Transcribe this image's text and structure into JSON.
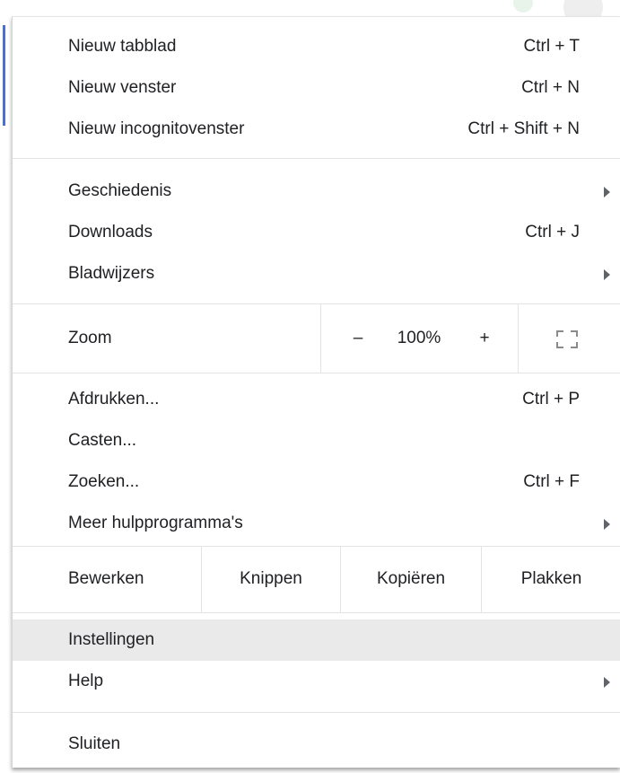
{
  "colors": {
    "accent": "#4a6fd1",
    "highlight": "#eaeaea",
    "separator": "#e3e3e3"
  },
  "menu": {
    "group1": [
      {
        "label": "Nieuw tabblad",
        "shortcut": "Ctrl + T"
      },
      {
        "label": "Nieuw venster",
        "shortcut": "Ctrl + N"
      },
      {
        "label": "Nieuw incognitovenster",
        "shortcut": "Ctrl + Shift + N"
      }
    ],
    "group2": [
      {
        "label": "Geschiedenis",
        "submenu": true
      },
      {
        "label": "Downloads",
        "shortcut": "Ctrl + J"
      },
      {
        "label": "Bladwijzers",
        "submenu": true
      }
    ],
    "zoom": {
      "label": "Zoom",
      "minus": "–",
      "value": "100%",
      "plus": "+",
      "fullscreen_icon": "fullscreen-icon"
    },
    "group3": [
      {
        "label": "Afdrukken...",
        "shortcut": "Ctrl + P"
      },
      {
        "label": "Casten..."
      },
      {
        "label": "Zoeken...",
        "shortcut": "Ctrl + F"
      },
      {
        "label": "Meer hulpprogramma's",
        "submenu": true
      }
    ],
    "edit": {
      "label": "Bewerken",
      "cut": "Knippen",
      "copy": "Kopiëren",
      "paste": "Plakken"
    },
    "group4": [
      {
        "label": "Instellingen",
        "highlighted": true
      },
      {
        "label": "Help",
        "submenu": true
      }
    ],
    "exit": {
      "label": "Sluiten"
    }
  }
}
